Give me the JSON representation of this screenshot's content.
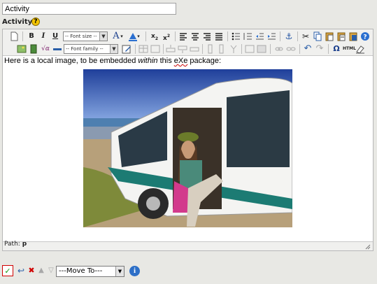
{
  "title_field": {
    "value": "Activity"
  },
  "section": {
    "label": "Activity"
  },
  "toolbar": {
    "font_size_label": "-- Font size --",
    "font_family_label": "-- Font family --",
    "html_label": "HTML"
  },
  "content": {
    "text_before": "Here is a local image, to be embedded ",
    "text_italic": "within",
    "text_middle": " this ",
    "text_ul": "eXe",
    "text_after": " package:"
  },
  "status": {
    "path_label": "Path:",
    "path_value": "p"
  },
  "actions": {
    "move_to_label": "---Move To---"
  },
  "colors": {
    "ok_green": "#119911",
    "delete_red": "#d00000",
    "info_blue": "#2d6fc7"
  }
}
